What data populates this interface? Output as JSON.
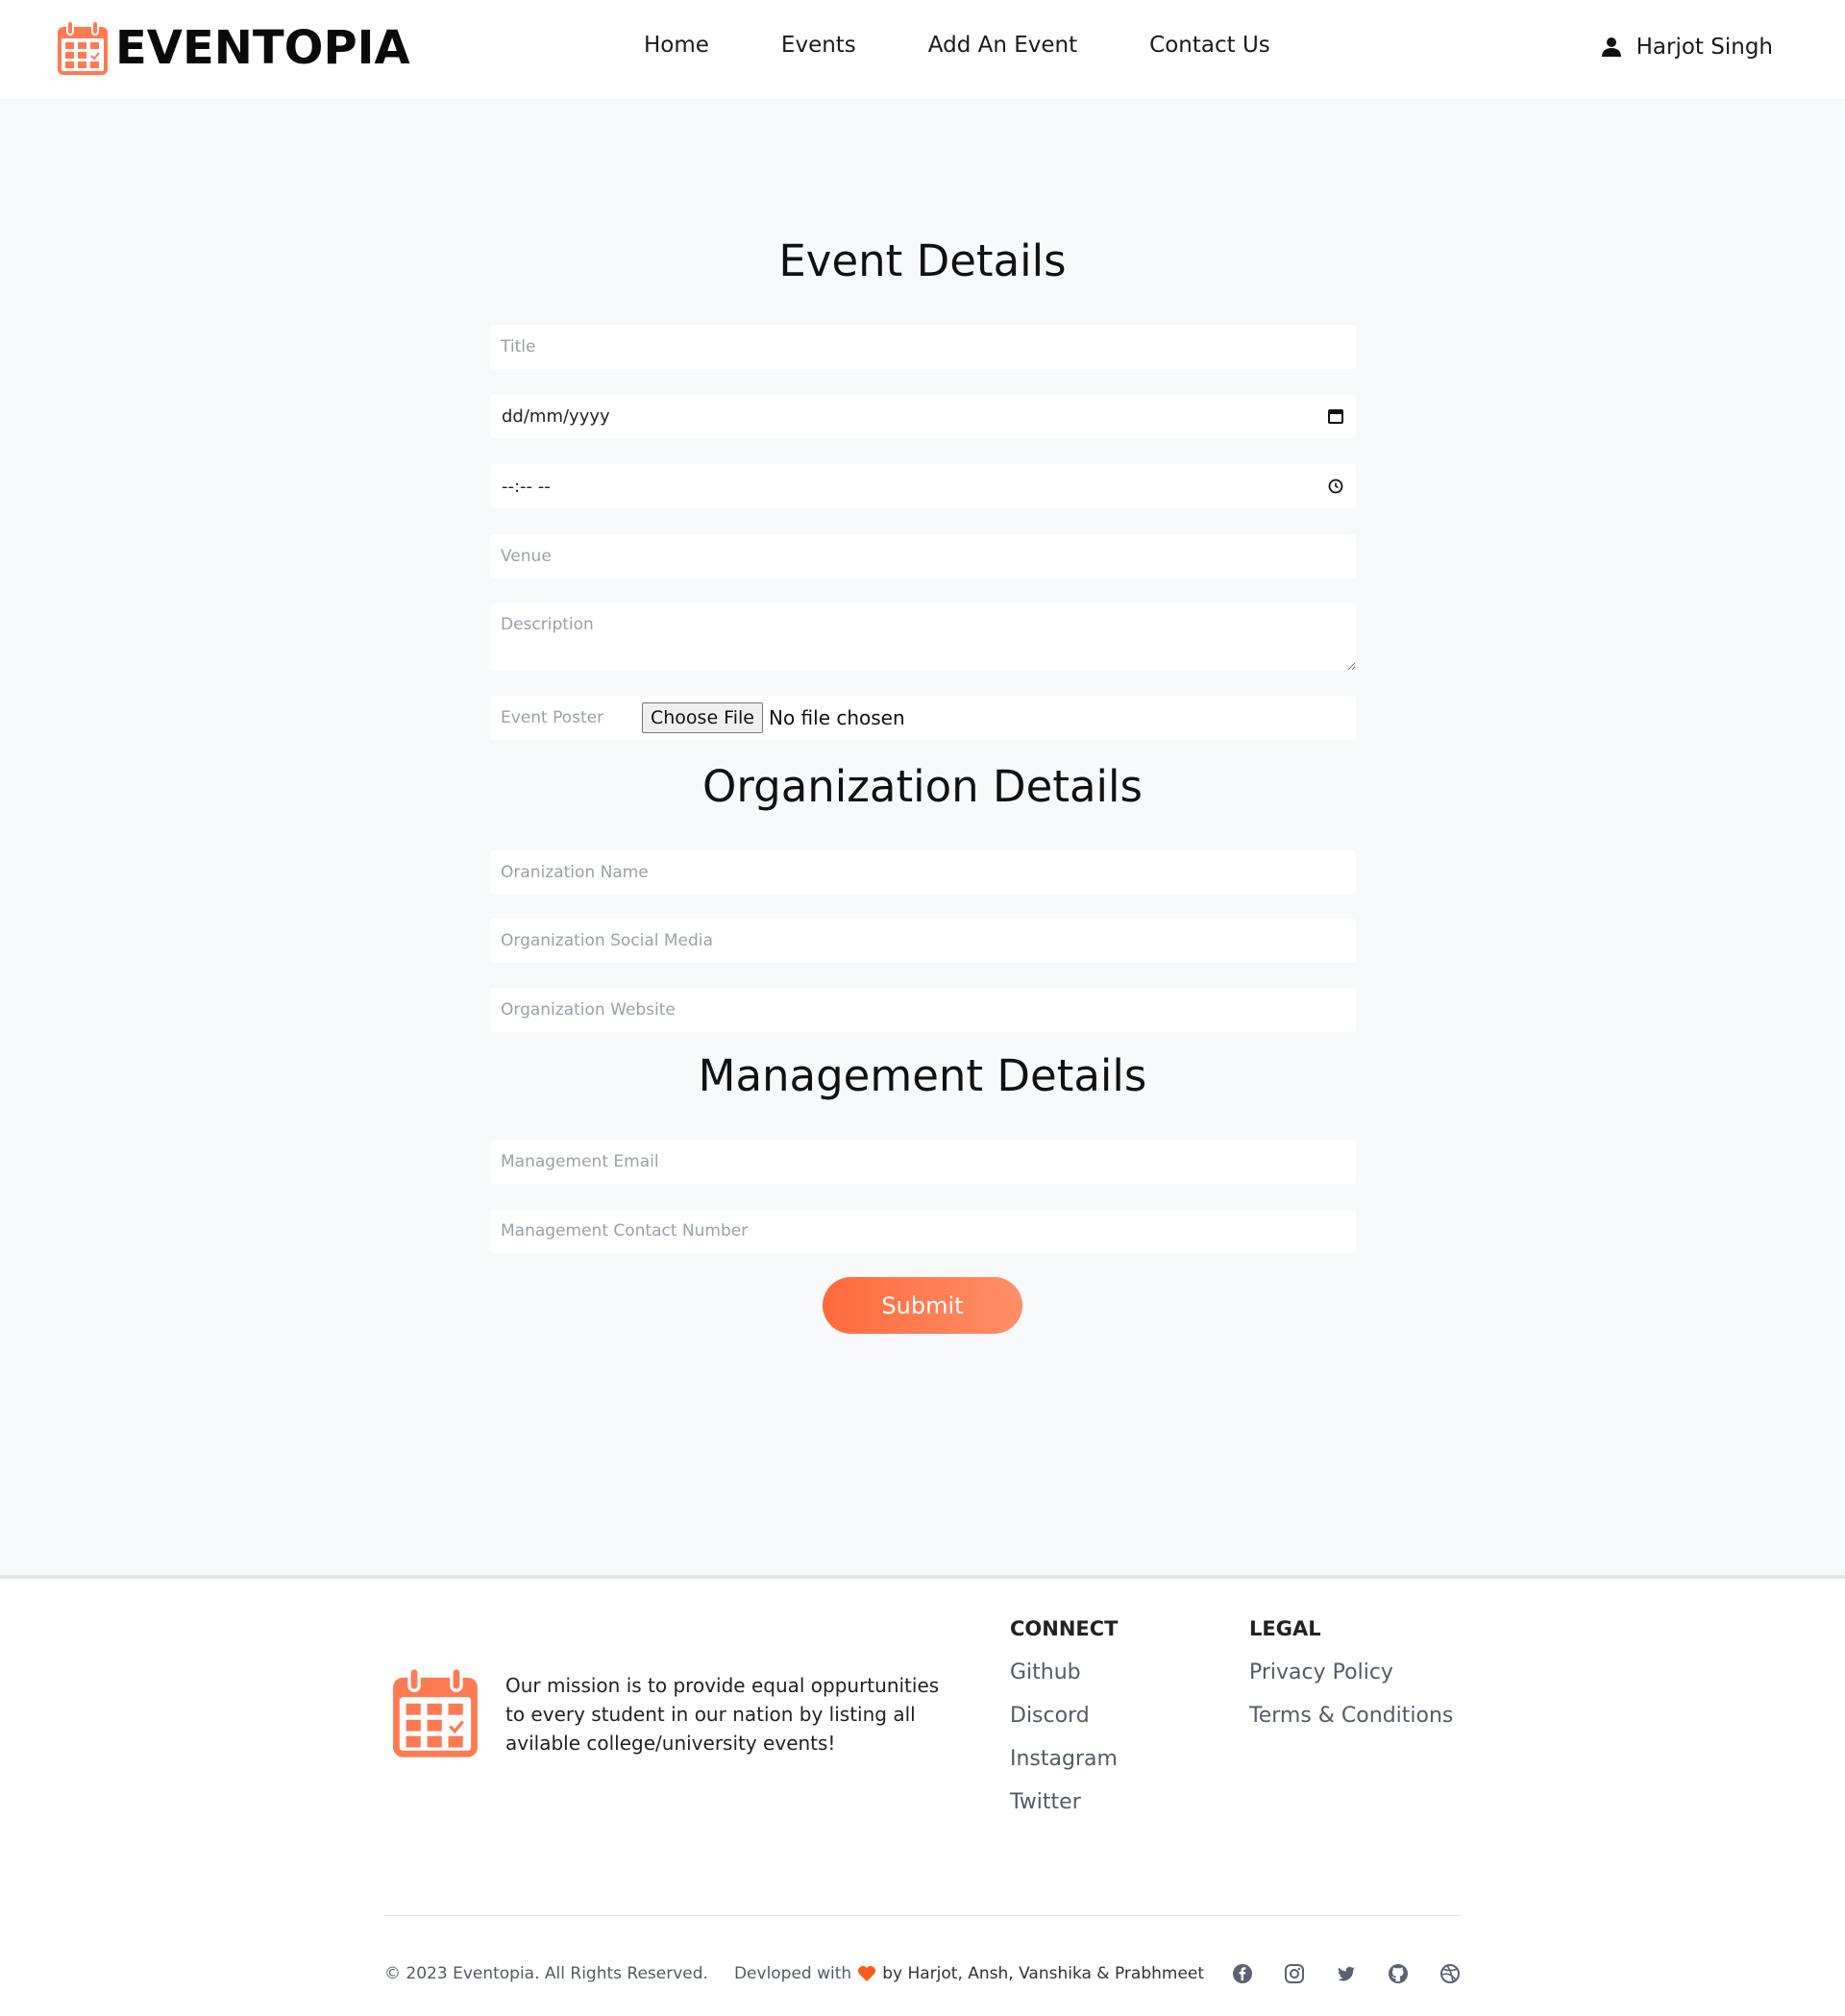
{
  "header": {
    "logo_text": "EVENTOPIA",
    "nav": [
      "Home",
      "Events",
      "Add An Event",
      "Contact Us"
    ],
    "user_name": "Harjot Singh"
  },
  "form": {
    "event_section_title": "Event Details",
    "title_placeholder": "Title",
    "date_placeholder": "dd/mm/yyyy",
    "time_placeholder": "--:-- --",
    "venue_placeholder": "Venue",
    "description_placeholder": "Description",
    "poster_label": "Event Poster",
    "poster_button": "Choose File",
    "poster_status": "No file chosen",
    "org_section_title": "Organization Details",
    "org_name_placeholder": "Oranization Name",
    "org_social_placeholder": "Organization Social Media",
    "org_website_placeholder": "Organization Website",
    "mgmt_section_title": "Management Details",
    "mgmt_email_placeholder": "Management Email",
    "mgmt_contact_placeholder": "Management Contact Number",
    "submit_label": "Submit"
  },
  "footer": {
    "mission": "Our mission is to provide equal oppurtunities to every student in our nation by listing all avilable college/university events!",
    "connect_title": "CONNECT",
    "connect_links": [
      "Github",
      "Discord",
      "Instagram",
      "Twitter"
    ],
    "legal_title": "LEGAL",
    "legal_links": [
      "Privacy Policy",
      "Terms & Conditions"
    ],
    "copyright": "© 2023 Eventopia. All Rights Reserved.",
    "developed_prefix": "Devloped with",
    "developed_by": "by Harjot, Ansh, Vanshika & Prabhmeet",
    "socials": [
      "facebook-icon",
      "instagram-icon",
      "twitter-icon",
      "github-icon",
      "dribbble-icon"
    ]
  },
  "colors": {
    "accent": "#ff6a3d",
    "background": "#f8f9fb"
  }
}
